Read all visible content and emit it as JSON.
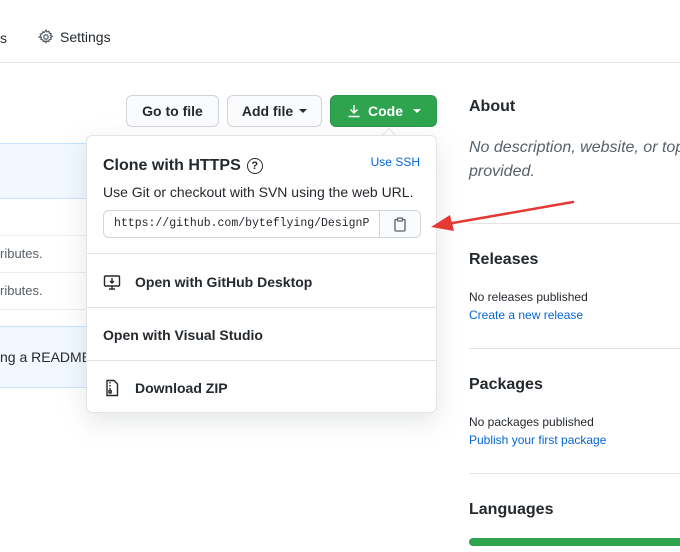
{
  "nav": {
    "fragment": "s",
    "settings_label": "Settings"
  },
  "files": {
    "row1_text": "ributes.",
    "row2_text": "ributes.",
    "readme_text": "ng a README"
  },
  "toolbar": {
    "goto_label": "Go to file",
    "addfile_label": "Add file",
    "code_label": "Code"
  },
  "clone": {
    "title": "Clone with HTTPS",
    "help_glyph": "?",
    "use_ssh": "Use SSH",
    "description": "Use Git or checkout with SVN using the web URL.",
    "url": "https://github.com/byteflying/DesignPatterns.git",
    "items": {
      "desktop": "Open with GitHub Desktop",
      "visual_studio": "Open with Visual Studio",
      "zip": "Download ZIP"
    }
  },
  "sidebar": {
    "about_title": "About",
    "about_desc_line1": "No description, website, or topi",
    "about_desc_line2": "provided.",
    "releases_title": "Releases",
    "releases_text": "No releases published",
    "releases_link": "Create a new release",
    "packages_title": "Packages",
    "packages_text": "No packages published",
    "packages_link": "Publish your first package",
    "languages_title": "Languages"
  },
  "colors": {
    "code_button": "#2ea44f",
    "link": "#0366d6",
    "annotation_arrow": "#e53935",
    "language_bar": "#2ea44f"
  },
  "icons": [
    "gear-icon",
    "download-icon",
    "question-icon",
    "clipboard-icon",
    "desktop-download-icon",
    "file-zip-icon"
  ]
}
